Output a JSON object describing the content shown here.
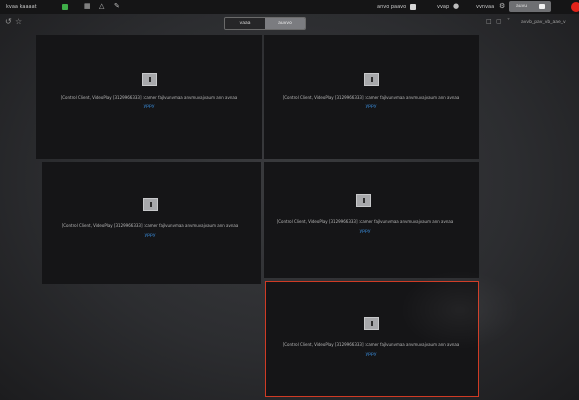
{
  "topbar": {
    "left_label": "kvaa  kaaaat",
    "user_label": "anvo paavo",
    "help_label": "vvap",
    "settings_label": "vvnvaa",
    "login_label": "auvu",
    "status_green": "#3fae49",
    "record_color": "#e2231a"
  },
  "subbar": {
    "view_tabs": [
      "vaaa",
      "auvvo"
    ],
    "active_tab": "auvvo",
    "right_status": "avvb_pav_vb_aae_v"
  },
  "tiles": [
    {
      "id": "tile-1",
      "error": "[Control Client, VideoPlay [3129966333] :camer fajlvunvmaa anvmuvajvaum ann avnaa",
      "link": "yppy",
      "selected": false
    },
    {
      "id": "tile-2",
      "error": "[Control Client, VideoPlay [3129966333] :camer fajlvunvmaa anvmuvajvaum ann avnaa",
      "link": "yppy",
      "selected": false
    },
    {
      "id": "tile-3",
      "error": "[Control Client, VideoPlay [3129966333] :camer fajlvunvmaa anvmuvajvaum ann avnaa",
      "link": "yppy",
      "selected": false
    },
    {
      "id": "tile-4",
      "error": "[Control Client, VideoPlay [3129966333] :camer fajlvunvmaa anvmuvajvaum ann avnaa",
      "link": "yppy",
      "selected": false
    },
    {
      "id": "tile-5",
      "error": "[Control Client, VideoPlay [3129966333] :camer fajlvunvmaa anvmuvajvaum ann avnaa",
      "link": "yppy",
      "selected": true
    }
  ]
}
